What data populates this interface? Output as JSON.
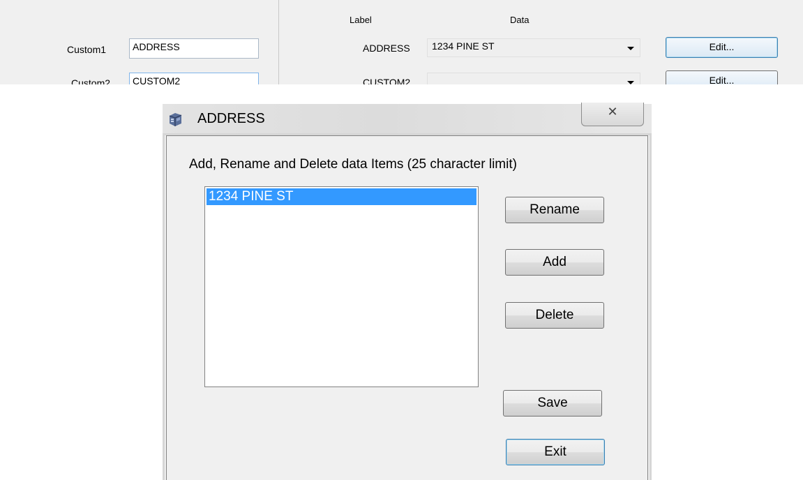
{
  "top_form": {
    "col_label_header": "Label",
    "col_data_header": "Data",
    "rows": [
      {
        "field_label": "Custom1",
        "field_value": "ADDRESS",
        "data_label": "ADDRESS",
        "data_value": "1234 PINE ST",
        "edit_label": "Edit..."
      },
      {
        "field_label": "Custom2",
        "field_value": "CUSTOM2",
        "data_label": "CUSTOM2",
        "data_value": "",
        "edit_label": "Edit..."
      }
    ]
  },
  "dialog": {
    "title": "ADDRESS",
    "title_icon": "phone-book-icon",
    "close_icon": "close-icon",
    "close_glyph": "✕",
    "instructions": "Add, Rename and Delete data Items (25 character limit)",
    "items": [
      "1234 PINE ST"
    ],
    "selected_index": 0,
    "buttons": {
      "rename": "Rename",
      "add": "Add",
      "delete": "Delete",
      "save": "Save",
      "exit": "Exit"
    }
  },
  "colors": {
    "selection": "#3399ff",
    "window_bg": "#f0f0f0",
    "focus_border": "#3c7fb1"
  }
}
